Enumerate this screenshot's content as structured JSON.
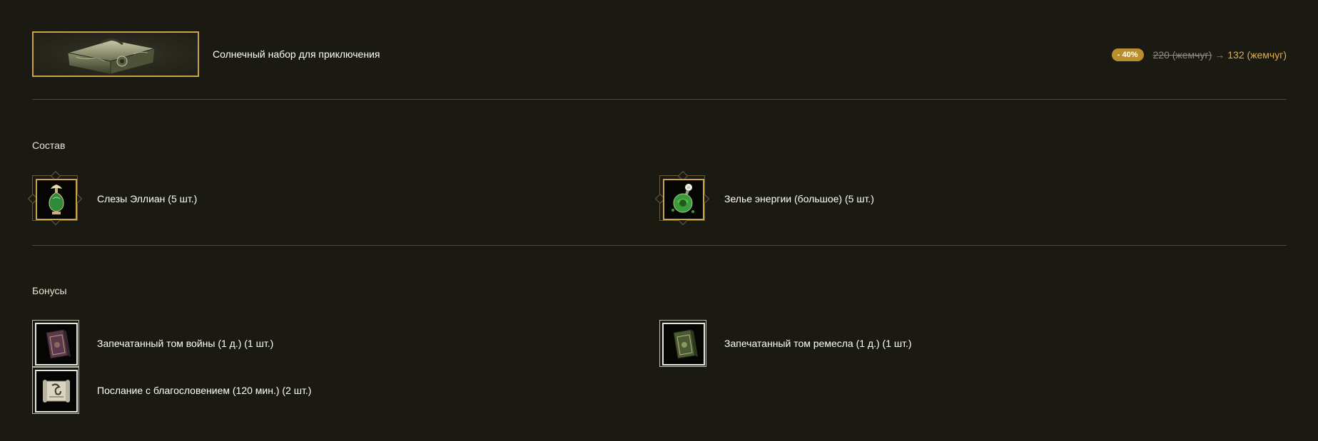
{
  "product": {
    "title": "Солнечный набор для приключения",
    "image_icon": "ornate-chest-icon",
    "price": {
      "discount": "- 40%",
      "old": "220 (жемчуг)",
      "arrow": "→",
      "new": "132 (жемчуг)"
    }
  },
  "contents": {
    "title": "Состав",
    "items": [
      {
        "label": "Слезы Эллиан (5 шт.)",
        "icon": "green-perfume-bottle-icon"
      },
      {
        "label": "Зелье энергии (большое) (5 шт.)",
        "icon": "green-potion-icon"
      }
    ]
  },
  "bonuses": {
    "title": "Бонусы",
    "items": [
      {
        "label": "Запечатанный том войны (1 д.) (1 шт.)",
        "icon": "purple-tome-icon"
      },
      {
        "label": "Запечатанный том ремесла (1 д.) (1 шт.)",
        "icon": "green-tome-icon"
      },
      {
        "label": "Послание с благословением (120 мин.) (2 шт.)",
        "icon": "scroll-icon"
      }
    ]
  },
  "colors": {
    "background": "#1b1a12",
    "accent_gold": "#c9a24a",
    "badge": "#b88e2e",
    "new_price": "#e0b04a",
    "old_price": "#8a8a80",
    "divider": "#4a483c"
  }
}
